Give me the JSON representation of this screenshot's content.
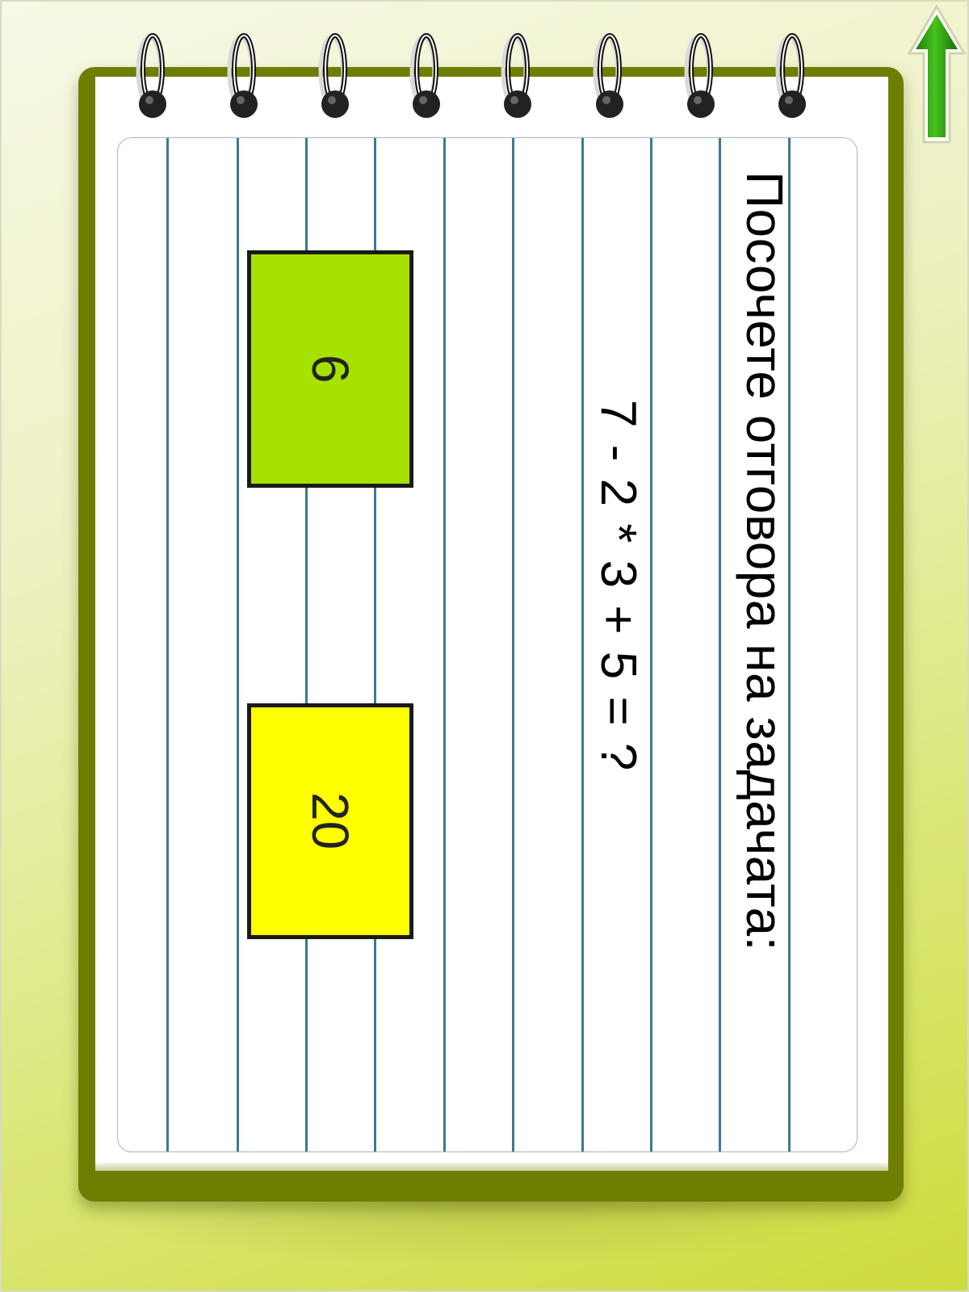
{
  "task": {
    "title": "Посочете отговора на задачата:",
    "equation": "7 - 2 * 3 + 5 = ?"
  },
  "answers": [
    {
      "label": "6",
      "color": "#a6e200"
    },
    {
      "label": "20",
      "color": "#ffff00"
    }
  ],
  "navigation": {
    "up_arrow_icon": "up-arrow-icon",
    "arrow_color": "#2f9a12"
  },
  "notebook": {
    "cover_color": "#6f7d00",
    "line_color": "#3f7891",
    "ring_count": 8
  }
}
